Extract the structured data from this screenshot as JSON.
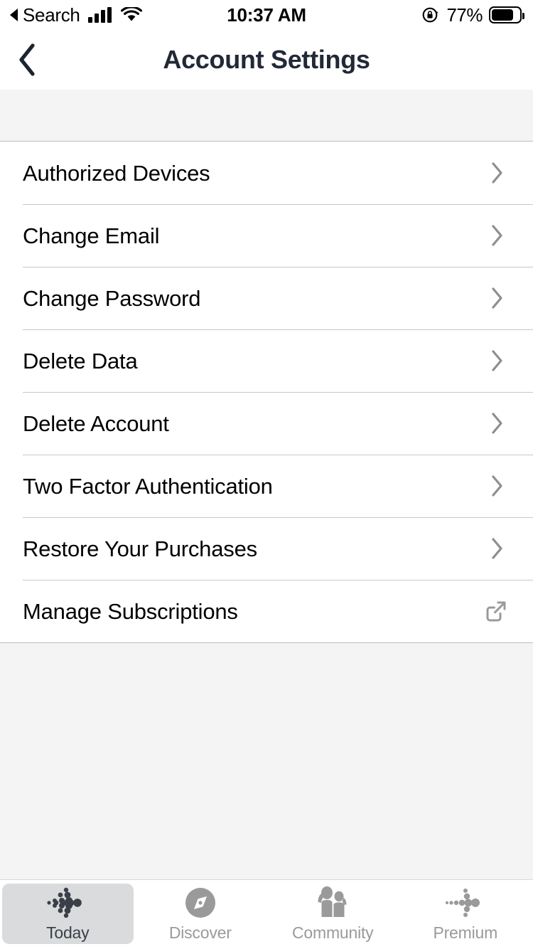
{
  "status_bar": {
    "back_label": "Search",
    "time": "10:37 AM",
    "battery_percent": "77%",
    "signal_icon": "cellular-signal-icon",
    "wifi_icon": "wifi-icon",
    "rotation_lock_icon": "rotation-lock-icon",
    "battery_icon": "battery-icon"
  },
  "navbar": {
    "back_icon": "chevron-left-icon",
    "title": "Account Settings"
  },
  "settings_list": {
    "rows": [
      {
        "label": "Authorized Devices",
        "accessory": "chevron-right-icon"
      },
      {
        "label": "Change Email",
        "accessory": "chevron-right-icon"
      },
      {
        "label": "Change Password",
        "accessory": "chevron-right-icon"
      },
      {
        "label": "Delete Data",
        "accessory": "chevron-right-icon"
      },
      {
        "label": "Delete Account",
        "accessory": "chevron-right-icon"
      },
      {
        "label": "Two Factor Authentication",
        "accessory": "chevron-right-icon"
      },
      {
        "label": "Restore Your Purchases",
        "accessory": "chevron-right-icon"
      },
      {
        "label": "Manage Subscriptions",
        "accessory": "external-link-icon"
      }
    ]
  },
  "tabbar": {
    "tabs": [
      {
        "label": "Today",
        "icon": "dot-arrow-icon",
        "selected": true
      },
      {
        "label": "Discover",
        "icon": "compass-icon",
        "selected": false
      },
      {
        "label": "Community",
        "icon": "people-icon",
        "selected": false
      },
      {
        "label": "Premium",
        "icon": "dot-arrow-icon",
        "selected": false
      }
    ]
  },
  "colors": {
    "page_background": "#f4f4f4",
    "surface": "#ffffff",
    "title": "#212936",
    "separator": "#c8c8c8",
    "accessory": "#8e8e93",
    "tab_inactive": "#9a9a9a",
    "tab_selected_bg": "#d9dbdd"
  }
}
